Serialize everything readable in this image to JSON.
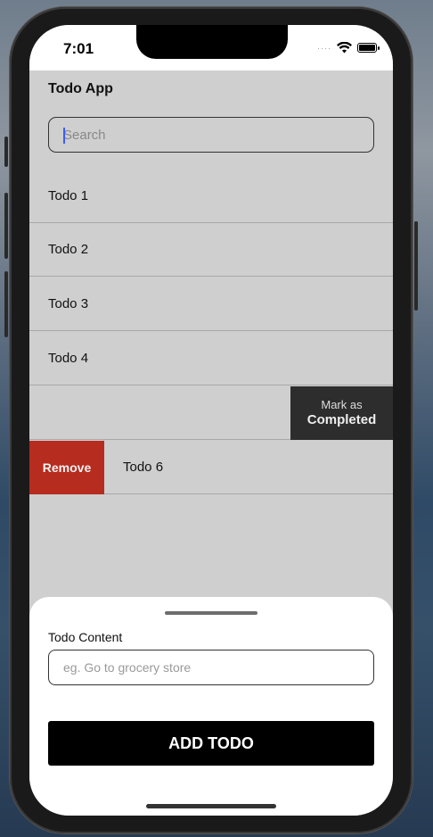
{
  "status": {
    "time": "7:01"
  },
  "app": {
    "title": "Todo App"
  },
  "search": {
    "placeholder": "Search"
  },
  "todos": [
    {
      "label": "Todo 1"
    },
    {
      "label": "Todo 2"
    },
    {
      "label": "Todo 3"
    },
    {
      "label": "Todo 4"
    },
    {
      "label": ""
    },
    {
      "label": "Todo 6"
    }
  ],
  "swipe_actions": {
    "mark_top": "Mark as",
    "mark_bottom": "Completed",
    "remove": "Remove"
  },
  "sheet": {
    "field_label": "Todo Content",
    "field_placeholder": "eg. Go to grocery store",
    "add_button": "ADD TODO"
  },
  "icons": [
    "signal-icon",
    "wifi-icon",
    "battery-icon"
  ],
  "colors": {
    "remove": "#b62c1f",
    "mark": "#2d2d2d",
    "add_button": "#000000",
    "background": "#cfcfcf"
  }
}
